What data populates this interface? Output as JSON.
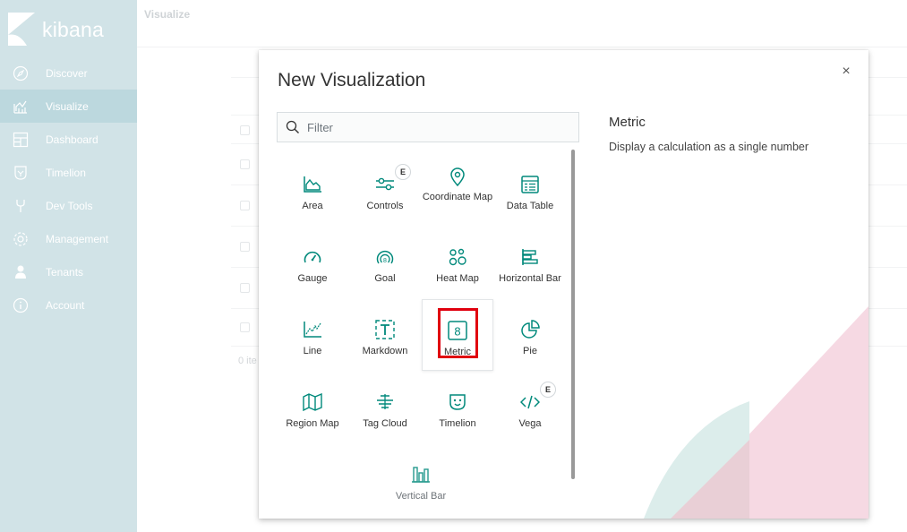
{
  "app": {
    "logo_text": "kibana"
  },
  "sidebar": {
    "items": [
      {
        "label": "Discover",
        "icon": "compass-icon"
      },
      {
        "label": "Visualize",
        "icon": "visualize-icon",
        "active": true
      },
      {
        "label": "Dashboard",
        "icon": "dashboard-icon"
      },
      {
        "label": "Timelion",
        "icon": "timelion-icon"
      },
      {
        "label": "Dev Tools",
        "icon": "wrench-icon"
      },
      {
        "label": "Management",
        "icon": "gear-icon"
      },
      {
        "label": "Tenants",
        "icon": "user-icon"
      },
      {
        "label": "Account",
        "icon": "info-icon"
      }
    ]
  },
  "page": {
    "title": "Visualize",
    "bg_hint": "0 ite"
  },
  "modal": {
    "title": "New Visualization",
    "close_symbol": "×",
    "filter": {
      "placeholder": "Filter",
      "value": ""
    },
    "badge_label": "E",
    "types": [
      {
        "label": "Area",
        "icon": "area-chart-icon"
      },
      {
        "label": "Controls",
        "icon": "controls-icon",
        "badge": "E"
      },
      {
        "label": "Coordinate Map",
        "icon": "map-pin-icon"
      },
      {
        "label": "Data Table",
        "icon": "table-icon"
      },
      {
        "label": "Gauge",
        "icon": "gauge-icon"
      },
      {
        "label": "Goal",
        "icon": "goal-icon"
      },
      {
        "label": "Heat Map",
        "icon": "heatmap-icon"
      },
      {
        "label": "Horizontal Bar",
        "icon": "horizontal-bar-icon"
      },
      {
        "label": "Line",
        "icon": "line-chart-icon"
      },
      {
        "label": "Markdown",
        "icon": "markdown-icon"
      },
      {
        "label": "Metric",
        "icon": "metric-icon",
        "selected": true
      },
      {
        "label": "Pie",
        "icon": "pie-chart-icon"
      },
      {
        "label": "Region Map",
        "icon": "region-map-icon"
      },
      {
        "label": "Tag Cloud",
        "icon": "tag-cloud-icon"
      },
      {
        "label": "Timelion",
        "icon": "timelion-icon"
      },
      {
        "label": "Vega",
        "icon": "code-icon",
        "badge": "E"
      },
      {
        "label": "Vertical Bar",
        "icon": "vertical-bar-icon"
      }
    ],
    "description": {
      "title": "Metric",
      "text": "Display a calculation as a single number"
    }
  },
  "colors": {
    "sidebar_bg": "#d1e3e7",
    "accent": "#00897b",
    "highlight": "#e0000f"
  }
}
